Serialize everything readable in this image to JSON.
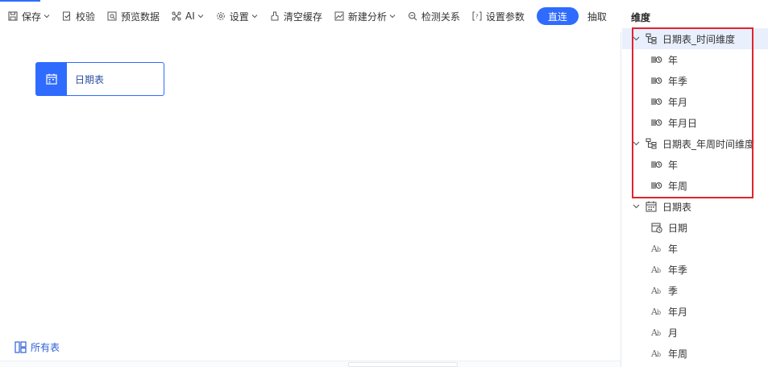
{
  "toolbar": {
    "save": "保存",
    "validate": "校验",
    "preview": "预览数据",
    "ai": "AI",
    "settings": "设置",
    "clear_cache": "清空缓存",
    "new_analysis": "新建分析",
    "detect_relations": "检测关系",
    "set_params": "设置参数",
    "mode_direct": "直连",
    "mode_extract": "抽取"
  },
  "canvas": {
    "table_node_label": "日期表",
    "all_tables": "所有表"
  },
  "panel": {
    "title": "维度",
    "groups": [
      {
        "label": "日期表_时间维度",
        "items": [
          "年",
          "年季",
          "年月",
          "年月日"
        ]
      },
      {
        "label": "日期表_年周时间维度",
        "items": [
          "年",
          "年周"
        ]
      }
    ],
    "table": {
      "label": "日期表",
      "date_field": "日期",
      "text_fields": [
        "年",
        "年季",
        "季",
        "年月",
        "月",
        "年周"
      ]
    }
  },
  "colors": {
    "accent": "#2f6bff",
    "highlight": "#e0242f"
  }
}
